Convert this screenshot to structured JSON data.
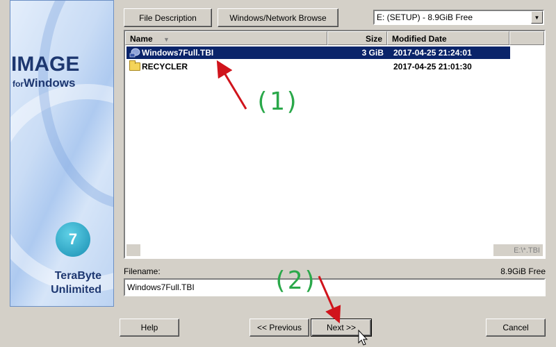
{
  "brand": {
    "title": "IMAGE",
    "sub_for": "for",
    "sub_windows": "Windows",
    "logo_glyph": "7",
    "company_line1": "TeraByte",
    "company_line2": "Unlimited"
  },
  "toolbar": {
    "file_description": "File Description",
    "network_browse": "Windows/Network Browse"
  },
  "drive_select": {
    "value": "E: (SETUP) - 8.9GiB Free"
  },
  "file_list": {
    "columns": [
      "Name",
      "Size",
      "Modified Date"
    ],
    "rows": [
      {
        "name": "Windows7Full.TBI",
        "size": "3 GiB",
        "modified": "2017-04-25 21:24:01",
        "selected": true,
        "icon": "image-file-icon"
      },
      {
        "name": "RECYCLER",
        "size": "",
        "modified": "2017-04-25 21:01:30",
        "selected": false,
        "icon": "folder-icon"
      }
    ],
    "path": "E:\\*.TBI"
  },
  "filename": {
    "label": "Filename:",
    "free_space": "8.9GiB Free",
    "value": "Windows7Full.TBI"
  },
  "footer": {
    "help": "Help",
    "previous": "<< Previous",
    "next": "Next >>",
    "cancel": "Cancel"
  },
  "annotations": {
    "step1": "(1)",
    "step2": "(2)",
    "color": "#d0141c"
  },
  "colors": {
    "selection": "#0a246a",
    "brand_text": "#1d3770",
    "annotation_text": "#2aa84a"
  }
}
